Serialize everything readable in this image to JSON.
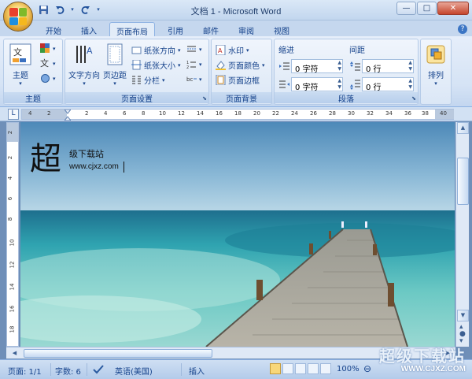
{
  "app": {
    "title": "文档 1 - Microsoft Word"
  },
  "quick_access": {
    "save_icon": "save-icon",
    "undo_icon": "undo-icon",
    "redo_icon": "redo-icon"
  },
  "tabs": [
    {
      "label": "开始"
    },
    {
      "label": "插入"
    },
    {
      "label": "页面布局",
      "active": true
    },
    {
      "label": "引用"
    },
    {
      "label": "邮件"
    },
    {
      "label": "审阅"
    },
    {
      "label": "视图"
    }
  ],
  "ribbon": {
    "themes": {
      "group_label": "主题",
      "themes_btn": "主题"
    },
    "page_setup": {
      "group_label": "页面设置",
      "text_direction": "文字方向",
      "margins": "页边距",
      "orientation": "纸张方向",
      "size": "纸张大小",
      "columns": "分栏"
    },
    "page_background": {
      "group_label": "页面背景",
      "watermark": "水印",
      "page_color": "页面颜色",
      "page_borders": "页面边框"
    },
    "paragraph": {
      "group_label": "段落",
      "indent_label": "缩进",
      "spacing_label": "间距",
      "indent_left": "0 字符",
      "indent_right": "0 字符",
      "spacing_before": "0 行",
      "spacing_after": "0 行"
    },
    "arrange": {
      "arrange_btn": "排列"
    }
  },
  "ruler": {
    "h_labels": [
      "4",
      "2",
      "2",
      "4",
      "6",
      "8",
      "10",
      "12",
      "14",
      "16",
      "18",
      "20",
      "22",
      "24",
      "26",
      "28",
      "30",
      "32",
      "34",
      "36",
      "38",
      "40"
    ],
    "v_labels": [
      "2",
      "2",
      "4",
      "6",
      "8",
      "10",
      "12",
      "14",
      "16",
      "18"
    ]
  },
  "document": {
    "title_big": "超",
    "title_small": "级下载站",
    "url": "www.cjxz.com"
  },
  "statusbar": {
    "page": "页面: 1/1",
    "words": "字数: 6",
    "language": "英语(美国)",
    "insert_mode": "插入",
    "zoom": "100%",
    "watermark_big": "超级下载站",
    "watermark_small": "WWW.CJXZ.COM"
  }
}
